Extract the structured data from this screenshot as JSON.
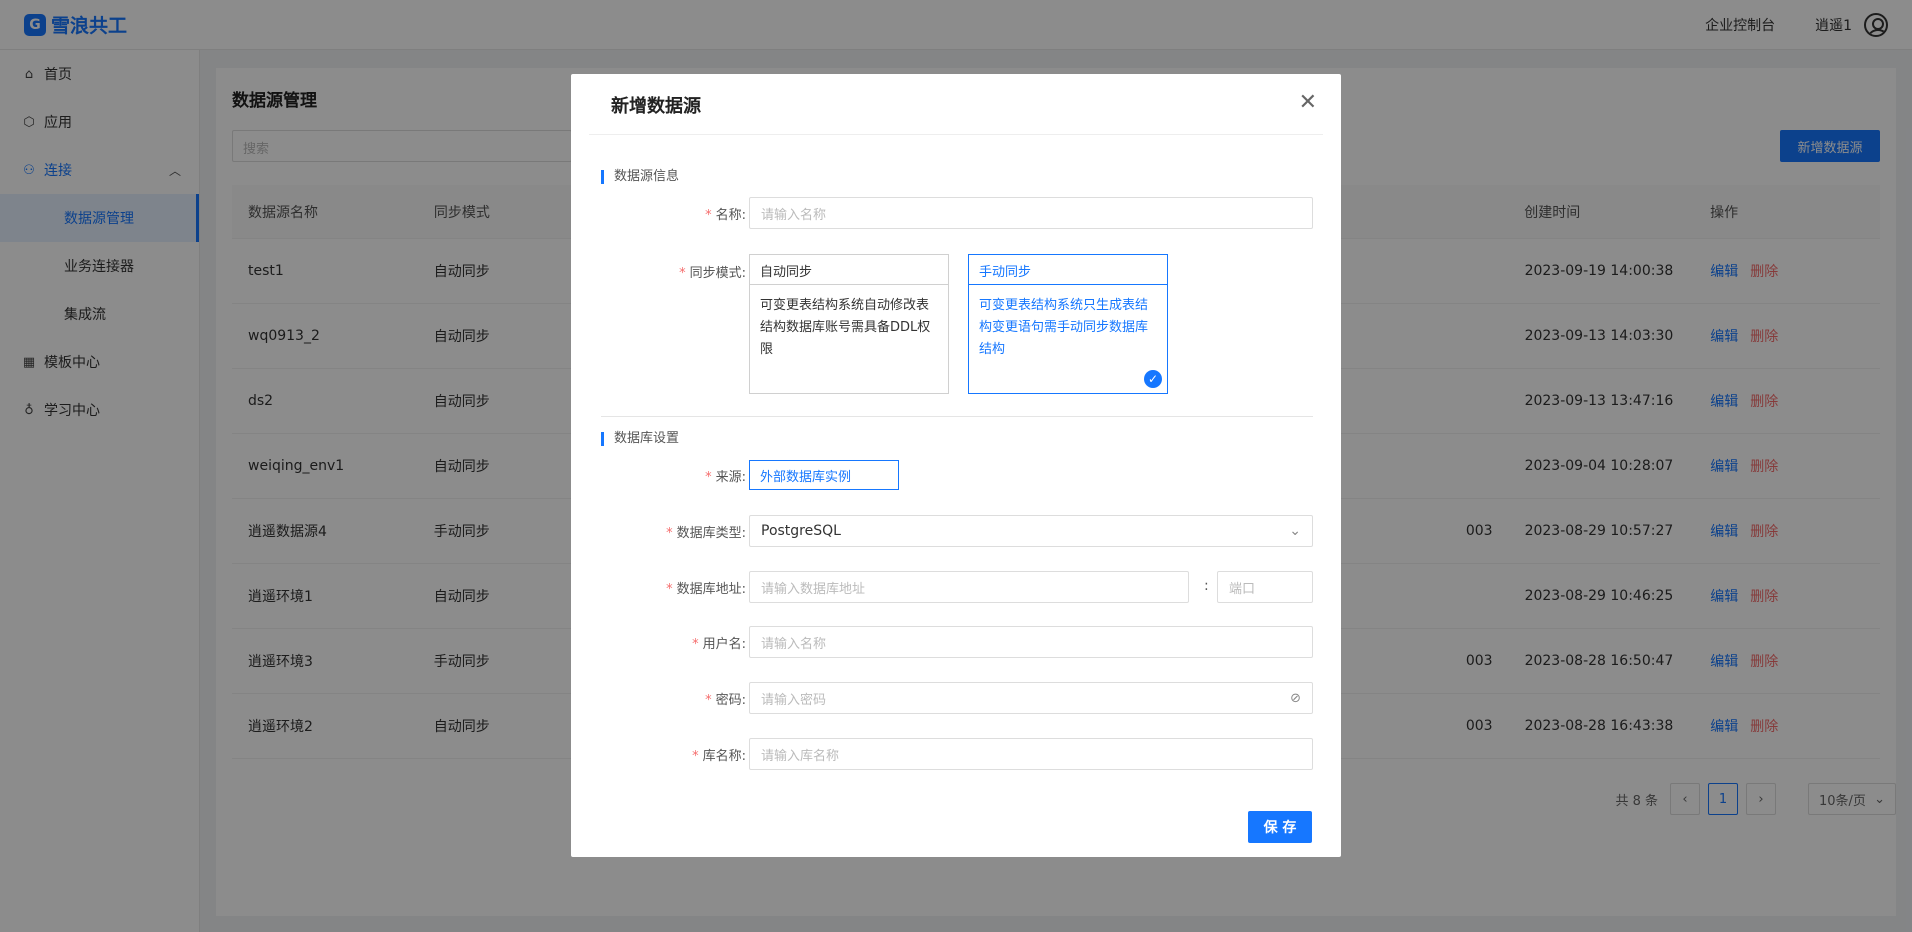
{
  "header": {
    "brand": "雪浪共工",
    "console_link": "企业控制台",
    "user_name": "逍遥1"
  },
  "sidebar": {
    "items": [
      {
        "label": "首页",
        "icon": "home-icon"
      },
      {
        "label": "应用",
        "icon": "cube-icon"
      },
      {
        "label": "连接",
        "icon": "connect-icon",
        "expanded": true,
        "children": [
          {
            "label": "数据源管理",
            "active": true
          },
          {
            "label": "业务连接器"
          },
          {
            "label": "集成流"
          }
        ]
      },
      {
        "label": "模板中心",
        "icon": "grid-icon"
      },
      {
        "label": "学习中心",
        "icon": "bulb-icon"
      }
    ]
  },
  "main": {
    "title": "数据源管理",
    "search_placeholder": "搜索",
    "add_button": "新增数据源",
    "table": {
      "headers": [
        "数据源名称",
        "同步模式",
        "创建时间",
        "操作"
      ],
      "rows": [
        {
          "name": "test1",
          "mode": "自动同步",
          "extra": "",
          "created": "2023-09-19 14:00:38"
        },
        {
          "name": "wq0913_2",
          "mode": "自动同步",
          "extra": "",
          "created": "2023-09-13 14:03:30"
        },
        {
          "name": "ds2",
          "mode": "自动同步",
          "extra": "",
          "created": "2023-09-13 13:47:16"
        },
        {
          "name": "weiqing_env1",
          "mode": "自动同步",
          "extra": "",
          "created": "2023-09-04 10:28:07"
        },
        {
          "name": "逍遥数据源4",
          "mode": "手动同步",
          "extra": "003",
          "created": "2023-08-29 10:57:27"
        },
        {
          "name": "逍遥环境1",
          "mode": "自动同步",
          "extra": "",
          "created": "2023-08-29 10:46:25"
        },
        {
          "name": "逍遥环境3",
          "mode": "手动同步",
          "extra": "003",
          "created": "2023-08-28 16:50:47"
        },
        {
          "name": "逍遥环境2",
          "mode": "自动同步",
          "extra": "003",
          "created": "2023-08-28 16:43:38"
        }
      ],
      "edit_label": "编辑",
      "delete_label": "删除"
    },
    "pagination": {
      "total": "共 8 条",
      "current_page": "1",
      "page_size": "10条/页"
    }
  },
  "modal": {
    "title": "新增数据源",
    "section_info": "数据源信息",
    "name_label": "名称:",
    "name_placeholder": "请输入名称",
    "sync_label": "同步模式:",
    "auto_title": "自动同步",
    "auto_desc": "可变更表结构系统自动修改表结构数据库账号需具备DDL权限",
    "manual_title": "手动同步",
    "manual_desc": "可变更表结构系统只生成表结构变更语句需手动同步数据库结构",
    "selected_mode": "手动同步",
    "section_db": "数据库设置",
    "source_label": "来源:",
    "source_value": "外部数据库实例",
    "db_type_label": "数据库类型:",
    "db_type_value": "PostgreSQL",
    "db_addr_label": "数据库地址:",
    "db_addr_placeholder": "请输入数据库地址",
    "port_colon": ":",
    "port_placeholder": "端口",
    "user_label": "用户名:",
    "user_placeholder": "请输入名称",
    "pwd_label": "密码:",
    "pwd_placeholder": "请输入密码",
    "dbname_label": "库名称:",
    "dbname_placeholder": "请输入库名称",
    "save_button": "保 存",
    "required_mark": "*"
  },
  "colors": {
    "primary": "#1677ff",
    "danger": "#f56c6c",
    "mask": "rgba(0,0,0,0.45)"
  }
}
